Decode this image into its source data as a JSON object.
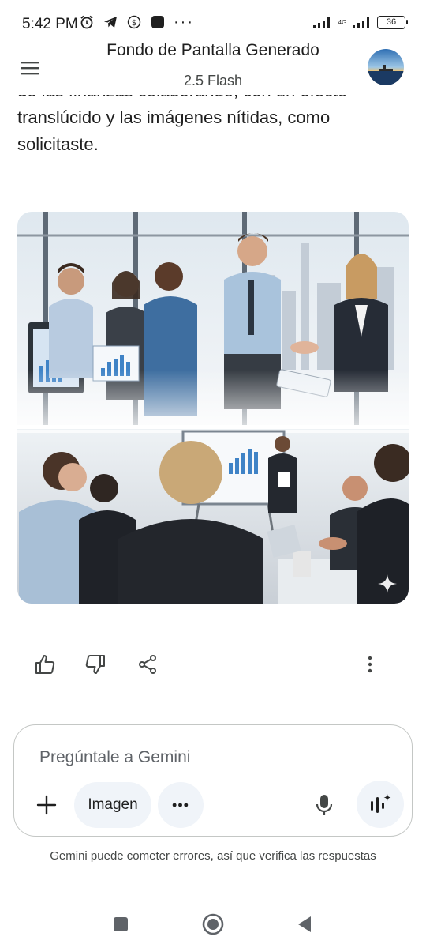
{
  "status_bar": {
    "time": "5:42 PM",
    "network_label": "4G",
    "battery_level": "36",
    "icons": [
      "alarm-icon",
      "telegram-icon",
      "money-icon",
      "app-square-icon",
      "more-dots-icon",
      "signal-icon",
      "signal-4g-icon",
      "battery-icon"
    ]
  },
  "header": {
    "title": "Fondo de Pantalla Generado",
    "subtitle": "2.5 Flash"
  },
  "message": {
    "cut_line": "de las finanzas colaborando, con un efecto",
    "visible_text": "translúcido y las imágenes nítidas, como solicitaste."
  },
  "actions": {
    "icons": [
      "thumbs-up-icon",
      "thumbs-down-icon",
      "share-icon",
      "more-vert-icon"
    ]
  },
  "input": {
    "placeholder": "Pregúntale a Gemini",
    "value": "",
    "image_chip": "Imagen",
    "more_chip": "•••"
  },
  "disclaimer": "Gemini puede cometer errores, así que verifica las respuestas",
  "colors": {
    "text": "#1f1f1f",
    "secondary_text": "#444746",
    "chip_bg": "#f0f4f9",
    "border": "#c4c7c5"
  }
}
